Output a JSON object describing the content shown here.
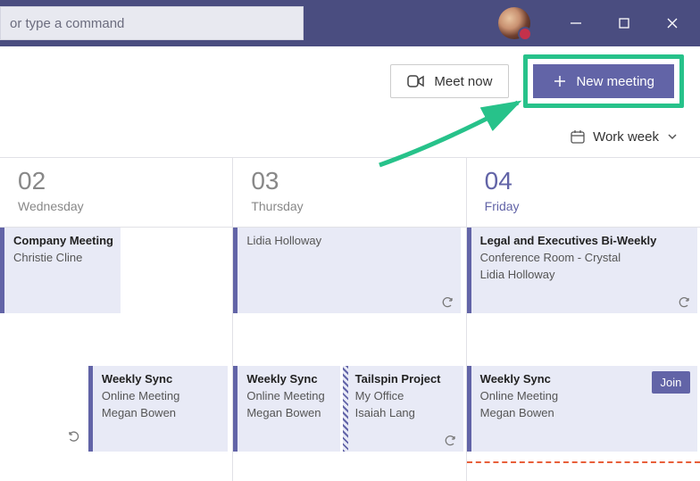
{
  "titlebar": {
    "search_placeholder": "or type a command"
  },
  "toolbar": {
    "meet_now_label": "Meet now",
    "new_meeting_label": "New meeting"
  },
  "view": {
    "label": "Work week"
  },
  "days": [
    {
      "number": "02",
      "name": "Wednesday",
      "today": false
    },
    {
      "number": "03",
      "name": "Thursday",
      "today": false
    },
    {
      "number": "04",
      "name": "Friday",
      "today": true
    }
  ],
  "events": {
    "d0_e0": {
      "title": "Company Meeting",
      "sub1": "Christie Cline"
    },
    "d0_e1": {
      "title": "Weekly Sync",
      "sub1": "Online Meeting",
      "sub2": "Megan Bowen"
    },
    "d1_e0": {
      "title": "Lidia Holloway"
    },
    "d1_e1": {
      "title": "Weekly Sync",
      "sub1": "Online Meeting",
      "sub2": "Megan Bowen"
    },
    "d1_e2": {
      "title": "Tailspin Project",
      "sub1": "My Office",
      "sub2": "Isaiah Lang"
    },
    "d2_e0": {
      "title": "Legal and Executives Bi-Weekly",
      "sub1": "Conference Room - Crystal",
      "sub2": "Lidia Holloway"
    },
    "d2_e1": {
      "title": "Weekly Sync",
      "sub1": "Online Meeting",
      "sub2": "Megan Bowen",
      "join": "Join"
    }
  }
}
